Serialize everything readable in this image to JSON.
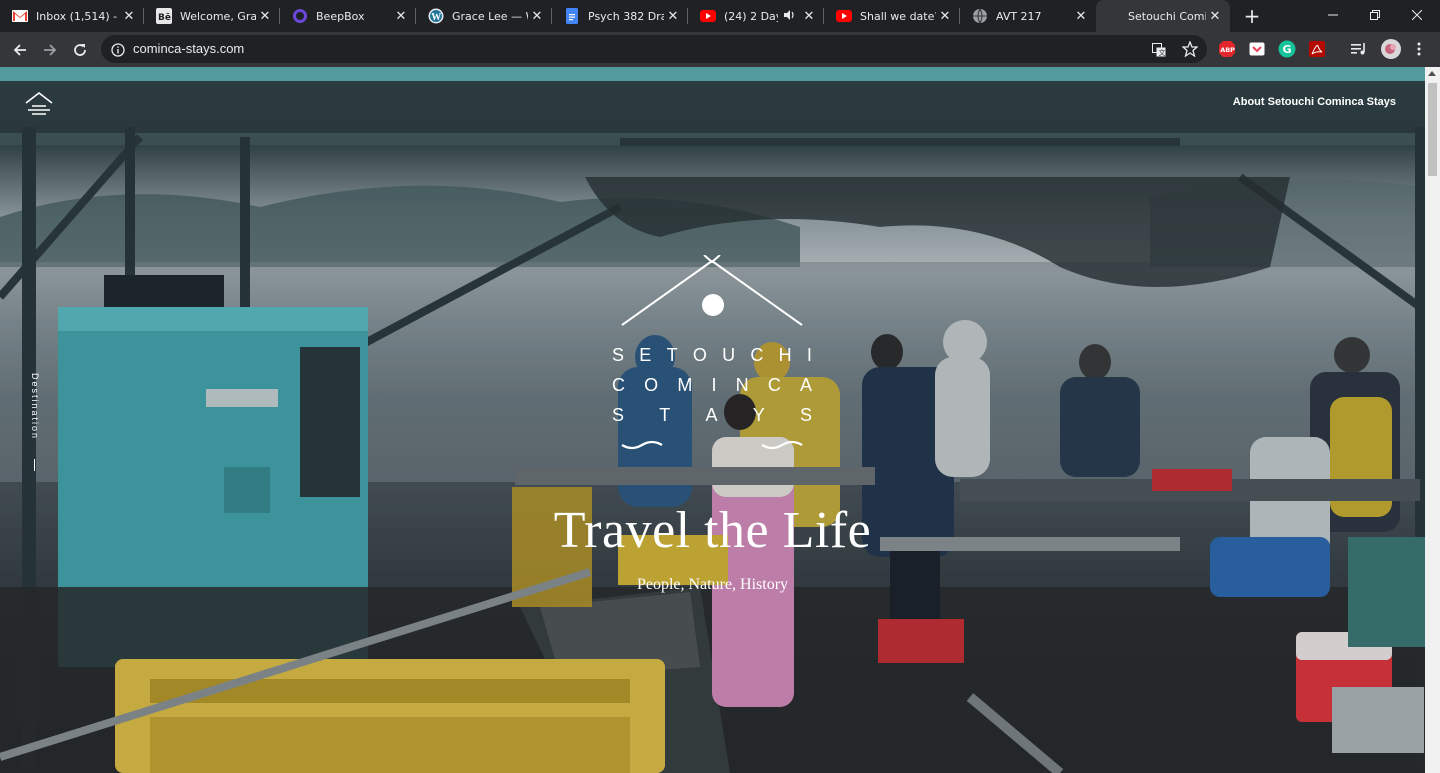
{
  "browser": {
    "tabs": [
      {
        "title": "Inbox (1,514) -",
        "icon": "gmail-icon",
        "active": false
      },
      {
        "title": "Welcome, Grac",
        "icon": "behance-icon",
        "active": false
      },
      {
        "title": "BeepBox",
        "icon": "beepbox-icon",
        "active": false
      },
      {
        "title": "Grace Lee — W",
        "icon": "wordpress-icon",
        "active": false
      },
      {
        "title": "Psych 382 Draf",
        "icon": "google-docs-icon",
        "active": false
      },
      {
        "title": "(24) 2 Days",
        "icon": "youtube-icon",
        "active": false,
        "audio": true
      },
      {
        "title": "Shall we date?",
        "icon": "youtube-icon",
        "active": false
      },
      {
        "title": "AVT 217",
        "icon": "globe-icon",
        "active": false
      },
      {
        "title": "Setouchi Comi",
        "icon": "",
        "active": true
      }
    ],
    "address": "cominca-stays.com",
    "colors": {
      "frame": "#202124",
      "toolbar": "#35363a",
      "omnibox": "#202124",
      "text": "#e8eaed"
    }
  },
  "page": {
    "nav": {
      "about": "About Setouchi Cominca Stays"
    },
    "side_label": "Destination",
    "brand": {
      "line1": [
        "S",
        "E",
        "T",
        "O",
        "U",
        "C",
        "H",
        "I"
      ],
      "line2": [
        "C",
        "O",
        "M",
        "I",
        "N",
        "C",
        "A"
      ],
      "line3": [
        "S",
        "T",
        "A",
        "Y",
        "S"
      ]
    },
    "title": "Travel the Life",
    "subtitle": "People, Nature, History"
  }
}
